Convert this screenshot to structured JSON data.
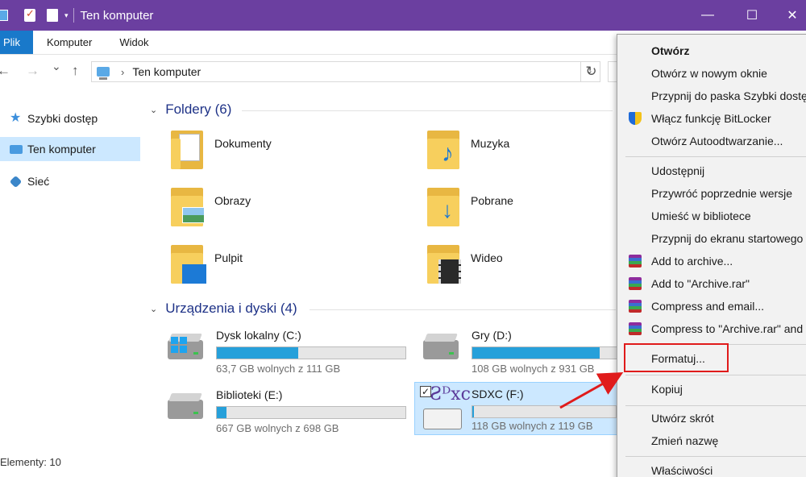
{
  "titlebar": {
    "title": "Ten komputer",
    "minimize_glyph": "—",
    "maximize_glyph": "☐",
    "close_glyph": "✕"
  },
  "ribbon": {
    "tabs": [
      {
        "label": "Plik"
      },
      {
        "label": "Komputer"
      },
      {
        "label": "Widok"
      }
    ]
  },
  "nav_controls": {
    "back_glyph": "←",
    "forward_glyph": "→",
    "recent_glyph": "⌄",
    "up_glyph": "↑",
    "refresh_glyph": "↻"
  },
  "address": {
    "path": "Ten komputer",
    "chevron": "›",
    "dropdown_glyph": "⌄"
  },
  "navpane": {
    "items": [
      {
        "label": "Szybki dostęp",
        "icon": "star-icon"
      },
      {
        "label": "Ten komputer",
        "icon": "computer-icon",
        "selected": true
      },
      {
        "label": "Sieć",
        "icon": "network-icon"
      }
    ]
  },
  "folders_section": {
    "heading": "Foldery (6)",
    "items": [
      {
        "label": "Dokumenty",
        "icon": "documents-folder-icon"
      },
      {
        "label": "Muzyka",
        "icon": "music-folder-icon"
      },
      {
        "label": "Obrazy",
        "icon": "pictures-folder-icon"
      },
      {
        "label": "Pobrane",
        "icon": "downloads-folder-icon"
      },
      {
        "label": "Pulpit",
        "icon": "desktop-folder-icon"
      },
      {
        "label": "Wideo",
        "icon": "videos-folder-icon"
      }
    ]
  },
  "drives_section": {
    "heading": "Urządzenia i dyski (4)",
    "items": [
      {
        "name": "Dysk lokalny (C:)",
        "free": "63,7 GB wolnych z 111 GB",
        "used_fraction": 0.43
      },
      {
        "name": "Gry (D:)",
        "free": "108 GB wolnych z 931 GB",
        "used_fraction": 0.88
      },
      {
        "name": "Biblioteki (E:)",
        "free": "667 GB wolnych z 698 GB",
        "used_fraction": 0.05
      },
      {
        "name": "SDXC (F:)",
        "free": "118 GB wolnych z 119 GB",
        "used_fraction": 0.01,
        "selected": true,
        "logo_text": "Ƨᴰxc",
        "check": "✓"
      }
    ]
  },
  "statusbar": {
    "text": "Elementy: 10"
  },
  "context_menu": {
    "groups": [
      [
        {
          "label": "Otwórz",
          "bold": true
        },
        {
          "label": "Otwórz w nowym oknie"
        },
        {
          "label": "Przypnij do paska Szybki dostęp"
        },
        {
          "label": "Włącz funkcję BitLocker",
          "icon": "shield-icon"
        },
        {
          "label": "Otwórz Autoodtwarzanie..."
        }
      ],
      [
        {
          "label": "Udostępnij"
        },
        {
          "label": "Przywróć poprzednie wersje"
        },
        {
          "label": "Umieść w bibliotece"
        },
        {
          "label": "Przypnij do ekranu startowego"
        },
        {
          "label": "Add to archive...",
          "icon": "winrar-icon"
        },
        {
          "label": "Add to \"Archive.rar\"",
          "icon": "winrar-icon"
        },
        {
          "label": "Compress and email...",
          "icon": "winrar-icon"
        },
        {
          "label": "Compress to \"Archive.rar\" and email",
          "icon": "winrar-icon"
        }
      ],
      [
        {
          "label": "Formatuj...",
          "highlighted": true
        }
      ],
      [
        {
          "label": "Kopiuj"
        }
      ],
      [
        {
          "label": "Utwórz skrót"
        },
        {
          "label": "Zmień nazwę"
        }
      ],
      [
        {
          "label": "Właściwości"
        }
      ]
    ]
  },
  "colors": {
    "titlebar": "#6b3fa0",
    "file_tab": "#1979ca",
    "selection": "#cce8ff",
    "drive_bar": "#26a0da",
    "annotation": "#e01b1b"
  }
}
